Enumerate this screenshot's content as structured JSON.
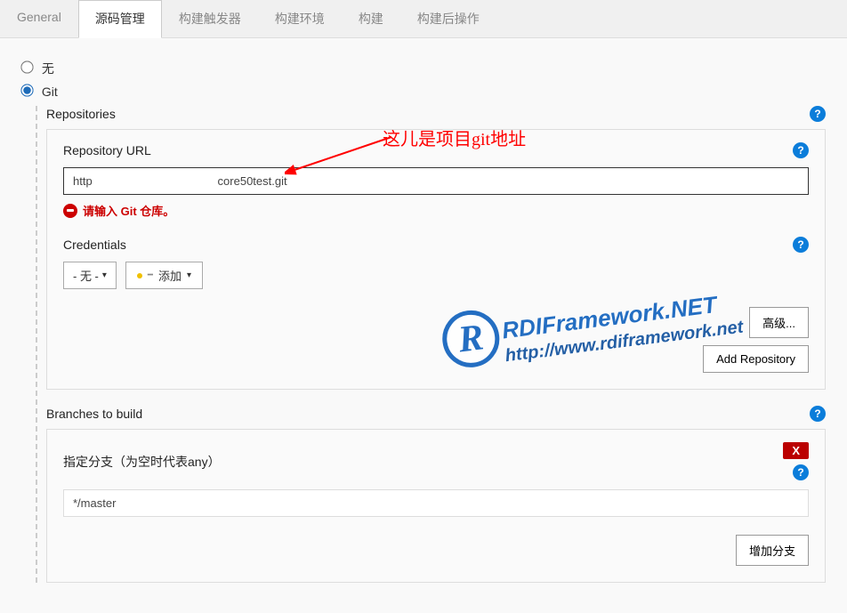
{
  "tabs": [
    {
      "label": "General",
      "active": false
    },
    {
      "label": "源码管理",
      "active": true
    },
    {
      "label": "构建触发器",
      "active": false
    },
    {
      "label": "构建环境",
      "active": false
    },
    {
      "label": "构建",
      "active": false
    },
    {
      "label": "构建后操作",
      "active": false
    }
  ],
  "scm": {
    "none_label": "无",
    "git_label": "Git",
    "selected": "git"
  },
  "repositories": {
    "title": "Repositories",
    "url_label": "Repository URL",
    "url_value": "http                                       core50test.git",
    "error_text": "请输入 Git 仓库。",
    "credentials_label": "Credentials",
    "cred_selected": "- 无 -",
    "add_label": "添加",
    "advanced_label": "高级...",
    "add_repo_label": "Add Repository"
  },
  "branches": {
    "title": "Branches to build",
    "spec_label": "指定分支（为空时代表any）",
    "spec_value": "*/master",
    "delete_label": "X",
    "add_branch_label": "增加分支"
  },
  "annotation": {
    "text": "这儿是项目git地址"
  },
  "watermark": {
    "logo_letter": "R",
    "line1": "RDIFramework.NET",
    "line2": "http://www.rdiframework.net"
  }
}
